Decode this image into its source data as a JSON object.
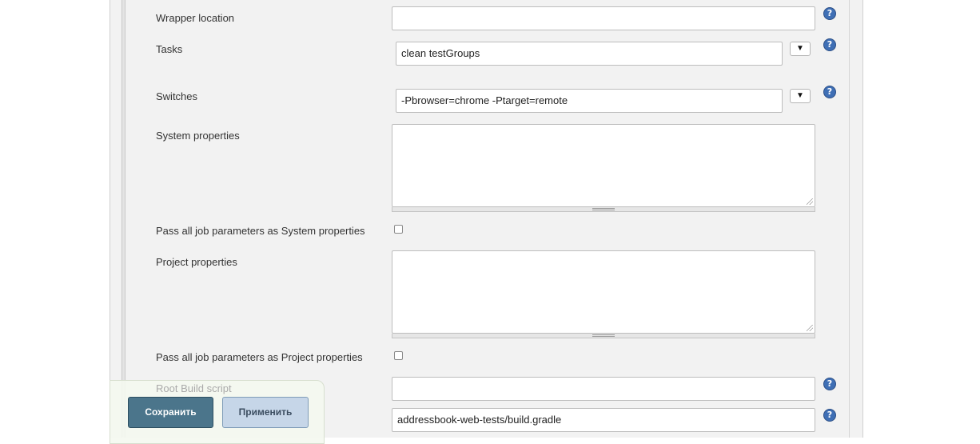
{
  "fields": {
    "wrapper_location": {
      "label": "Wrapper location",
      "value": ""
    },
    "tasks": {
      "label": "Tasks",
      "value": "clean testGroups",
      "dropdown_glyph": "▼"
    },
    "switches": {
      "label": "Switches",
      "value": "-Pbrowser=chrome -Ptarget=remote",
      "dropdown_glyph": "▼"
    },
    "system_properties": {
      "label": "System properties",
      "value": ""
    },
    "pass_system": {
      "label": "Pass all job parameters as System properties",
      "checked": false
    },
    "project_properties": {
      "label": "Project properties",
      "value": ""
    },
    "pass_project": {
      "label": "Pass all job parameters as Project properties",
      "checked": false
    },
    "root_build_script": {
      "label": "Root Build script",
      "value": ""
    },
    "build_file": {
      "value": "addressbook-web-tests/build.gradle"
    }
  },
  "help_glyph": "?",
  "footer": {
    "save_label": "Сохранить",
    "apply_label": "Применить"
  },
  "colors": {
    "save_button": "#4b758b",
    "apply_button": "#c6d6e8",
    "help_icon": "#3f6fb5"
  }
}
